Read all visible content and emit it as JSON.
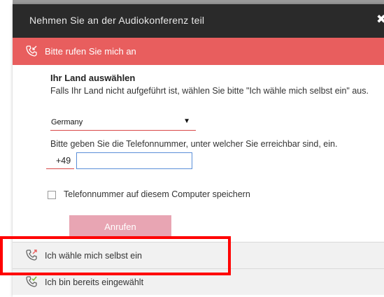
{
  "dialog": {
    "title": "Nehmen Sie an der Audiokonferenz teil",
    "close_symbol": "✖"
  },
  "call_me": {
    "label": "Bitte rufen Sie mich an",
    "icon": "phone-incoming-icon"
  },
  "form": {
    "country_heading": "Ihr Land auswählen",
    "country_hint": "Falls Ihr Land nicht aufgeführt ist, wählen Sie bitte \"Ich wähle mich selbst ein\" aus.",
    "country_value": "Germany",
    "country_arrow": "▼",
    "phone_hint": "Bitte geben Sie die Telefonnummer, unter welcher Sie erreichbar sind, ein.",
    "phone_prefix": "+49",
    "phone_value": "",
    "save_label": "Telefonnummer auf diesem Computer speichern",
    "save_checked": false,
    "call_button": "Anrufen"
  },
  "options": [
    {
      "label": "Ich wähle mich selbst ein",
      "icon": "phone-outgoing-icon"
    },
    {
      "label": "Ich bin bereits eingewählt",
      "icon": "phone-connected-icon"
    }
  ],
  "colors": {
    "title_bar": "#2a2a2a",
    "accent_red": "#e85e5e",
    "button_disabled": "#e8a5b3",
    "input_focus": "#5b8fd8",
    "highlight_frame": "#ff0000"
  }
}
